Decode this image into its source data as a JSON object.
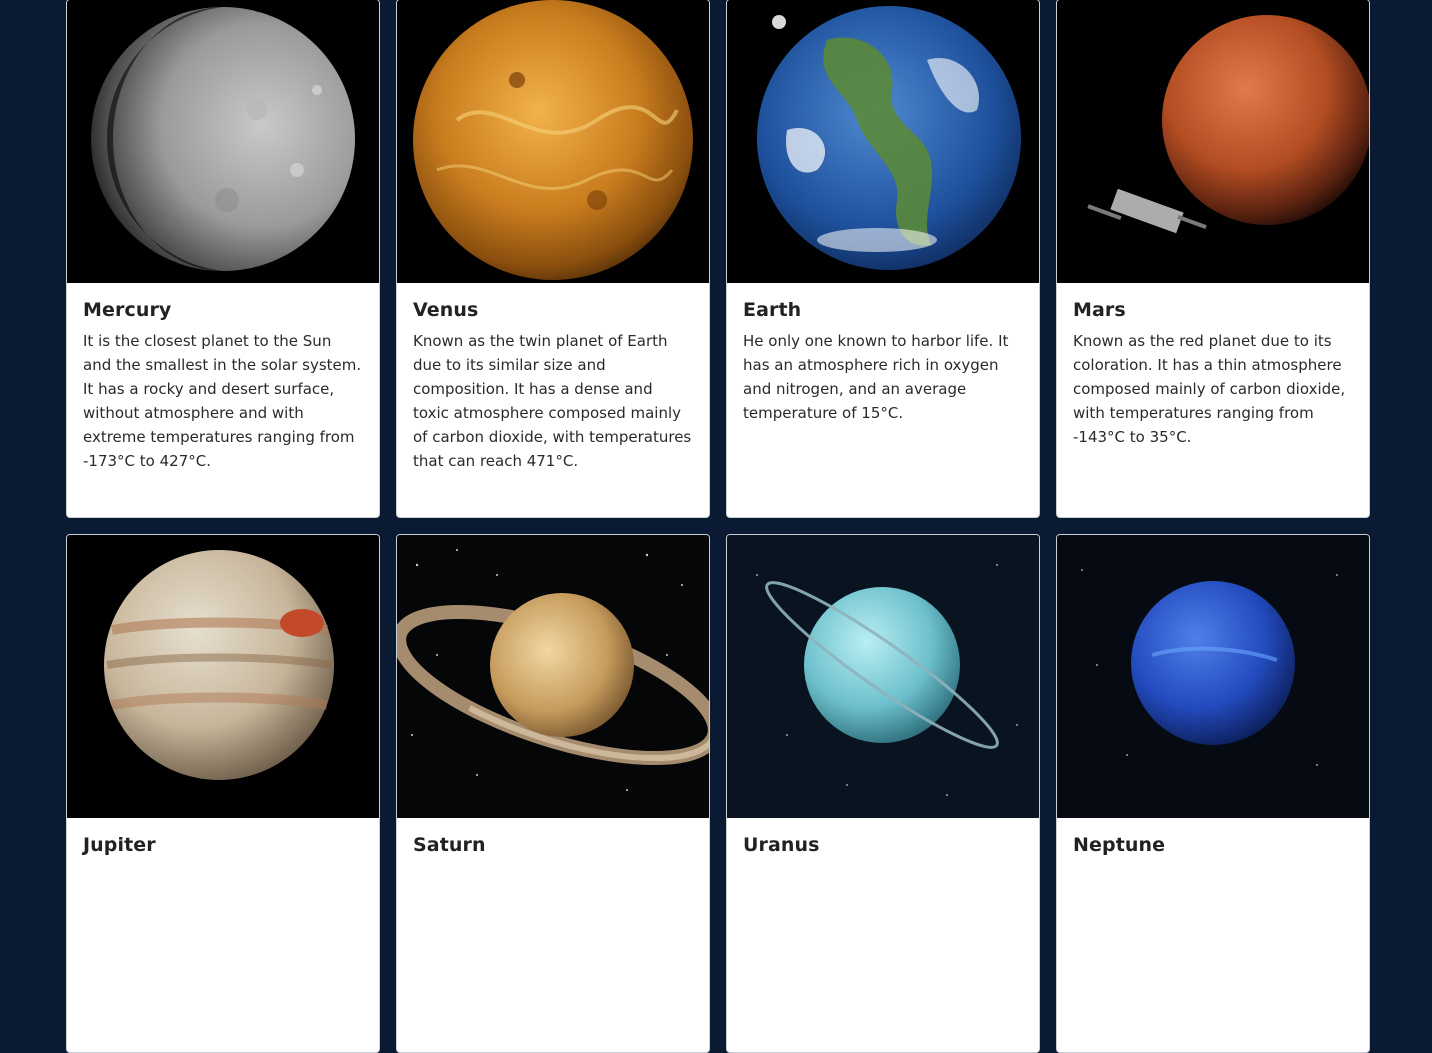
{
  "planets": [
    {
      "name": "Mercury",
      "description": "It is the closest planet to the Sun and the smallest in the solar system. It has a rocky and desert surface, without atmosphere and with extreme temperatures ranging from -173°C to 427°C.",
      "image": "mercury-image"
    },
    {
      "name": "Venus",
      "description": "Known as the twin planet of Earth due to its similar size and composition. It has a dense and toxic atmosphere composed mainly of carbon dioxide, with temperatures that can reach 471°C.",
      "image": "venus-image"
    },
    {
      "name": "Earth",
      "description": "He only one known to harbor life. It has an atmosphere rich in oxygen and nitrogen, and an average temperature of 15°C.",
      "image": "earth-image"
    },
    {
      "name": "Mars",
      "description": "Known as the red planet due to its coloration. It has a thin atmosphere composed mainly of carbon dioxide, with temperatures ranging from -143°C to 35°C.",
      "image": "mars-image"
    },
    {
      "name": "Jupiter",
      "description": "",
      "image": "jupiter-image"
    },
    {
      "name": "Saturn",
      "description": "",
      "image": "saturn-image"
    },
    {
      "name": "Uranus",
      "description": "",
      "image": "uranus-image"
    },
    {
      "name": "Neptune",
      "description": "",
      "image": "neptune-image"
    }
  ],
  "colors": {
    "page_background": "#0b1a33",
    "card_background": "#ffffff",
    "image_background": "#000000"
  }
}
